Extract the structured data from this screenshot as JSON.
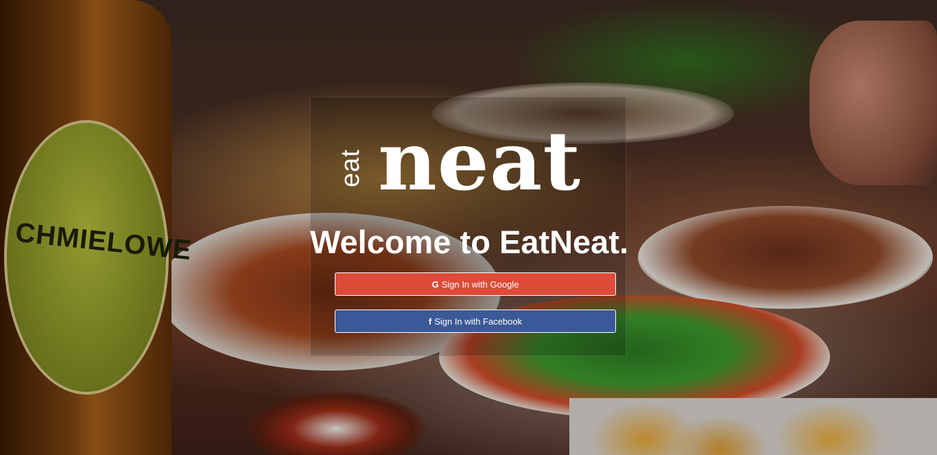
{
  "logo": {
    "small_text": "eat",
    "large_text": "neat"
  },
  "welcome": {
    "title": "Welcome to EatNeat."
  },
  "buttons": {
    "google": {
      "icon": "google-icon",
      "glyph": "G",
      "label": "Sign In with Google",
      "color": "#dd4b39"
    },
    "facebook": {
      "icon": "facebook-icon",
      "glyph": "f",
      "label": "Sign In with Facebook",
      "color": "#3b5998"
    }
  },
  "background": {
    "bottle_label": "CHMIELOWE"
  }
}
